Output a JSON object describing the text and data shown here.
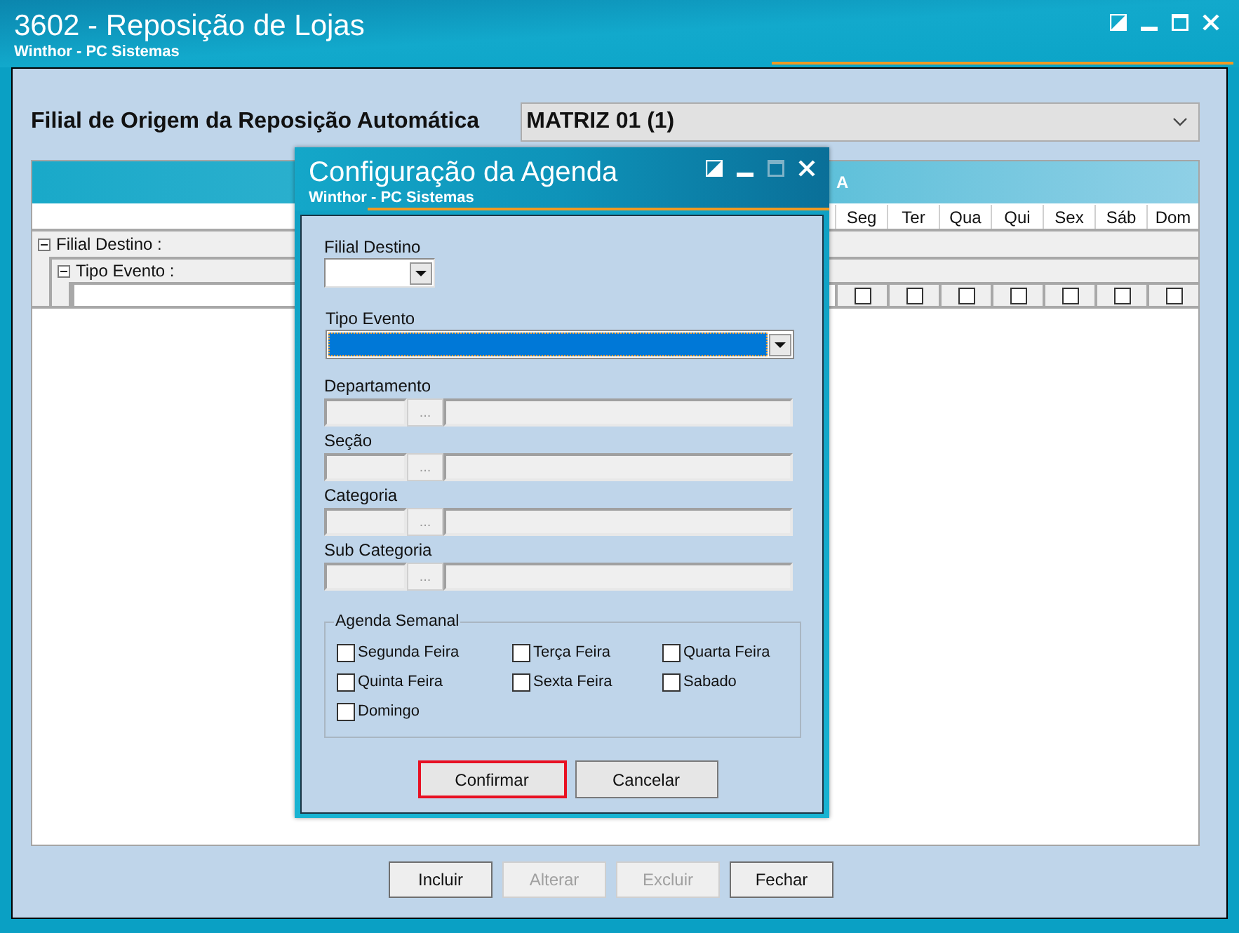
{
  "window": {
    "title": "3602 - Reposição de Lojas",
    "subtitle": "Winthor - PC Sistemas"
  },
  "origin": {
    "label": "Filial de Origem da Reposição Automática",
    "value": "MATRIZ 01 (1)"
  },
  "grid": {
    "title": "A",
    "day_columns": [
      "Seg",
      "Ter",
      "Qua",
      "Qui",
      "Sex",
      "Sáb",
      "Dom"
    ],
    "groups": [
      {
        "label": "Filial Destino :",
        "expanded": true,
        "children": [
          {
            "label": "Tipo Evento :",
            "expanded": true
          }
        ]
      }
    ],
    "rows": [
      {
        "days": [
          {
            "checked": false
          },
          {
            "checked": false
          },
          {
            "checked": false
          },
          {
            "checked": false
          },
          {
            "checked": false
          },
          {
            "checked": false
          },
          {
            "checked": false
          }
        ]
      }
    ]
  },
  "buttons": [
    {
      "label": "Incluir",
      "disabled": false
    },
    {
      "label": "Alterar",
      "disabled": true
    },
    {
      "label": "Excluir",
      "disabled": true
    },
    {
      "label": "Fechar",
      "disabled": false
    }
  ],
  "dialog": {
    "title": "Configuração da Agenda",
    "subtitle": "Winthor - PC Sistemas",
    "filial_destino": {
      "label": "Filial Destino"
    },
    "tipo_evento": {
      "label": "Tipo Evento",
      "focused": true
    },
    "lookups": [
      {
        "label": "Departamento",
        "button_label": "...",
        "disabled": true
      },
      {
        "label": "Seção",
        "button_label": "...",
        "disabled": true
      },
      {
        "label": "Categoria",
        "button_label": "...",
        "disabled": true
      },
      {
        "label": "Sub Categoria",
        "button_label": "...",
        "disabled": true
      }
    ],
    "weekly": {
      "title": "Agenda Semanal",
      "days": [
        {
          "label": "Segunda Feira",
          "checked": false
        },
        {
          "label": "Terça Feira",
          "checked": false
        },
        {
          "label": "Quarta Feira",
          "checked": false
        },
        {
          "label": "Quinta Feira",
          "checked": false
        },
        {
          "label": "Sexta Feira",
          "checked": false
        },
        {
          "label": "Sabado",
          "checked": false
        },
        {
          "label": "Domingo",
          "checked": false
        }
      ]
    },
    "buttons": [
      {
        "label": "Confirmar",
        "highlighted": true
      },
      {
        "label": "Cancelar",
        "highlighted": false
      }
    ]
  }
}
